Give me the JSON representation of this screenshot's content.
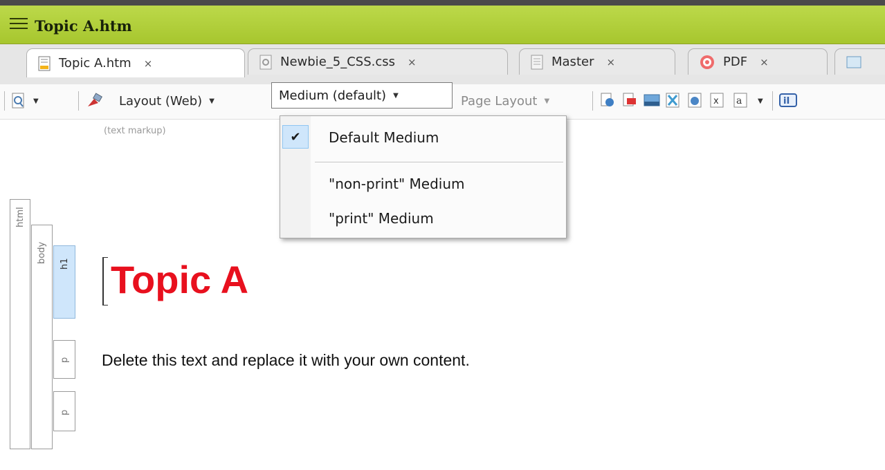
{
  "window": {
    "title": "Topic A.htm"
  },
  "tabs": [
    {
      "label": "Topic A.htm",
      "close": "×",
      "icon": "document-icon",
      "active": true
    },
    {
      "label": "Newbie_5_CSS.css",
      "close": "×",
      "icon": "css-file-icon",
      "active": false
    },
    {
      "label": "Master",
      "close": "×",
      "icon": "page-layout-icon",
      "active": false
    },
    {
      "label": "PDF",
      "close": "×",
      "icon": "target-icon",
      "active": false
    }
  ],
  "toolbar": {
    "layout_label": "Layout (Web)",
    "medium_label": "Medium (default)",
    "page_layout_label": "Page Layout",
    "hint": "(text markup)"
  },
  "medium_menu": {
    "items": [
      {
        "label": "Default Medium",
        "checked": true
      },
      {
        "label": "\"non-print\" Medium",
        "checked": false
      },
      {
        "label": "\"print\" Medium",
        "checked": false
      }
    ],
    "check_glyph": "✔"
  },
  "structure_bars": {
    "html": "html",
    "body": "body",
    "h1": "h1",
    "p1": "p",
    "p2": "p"
  },
  "document": {
    "heading": "Topic A",
    "paragraph": "Delete this text and replace it with your own content."
  },
  "colors": {
    "titlebar": "#b2d235",
    "heading": "#e8101e",
    "selected_tag": "#cfe6fb"
  }
}
